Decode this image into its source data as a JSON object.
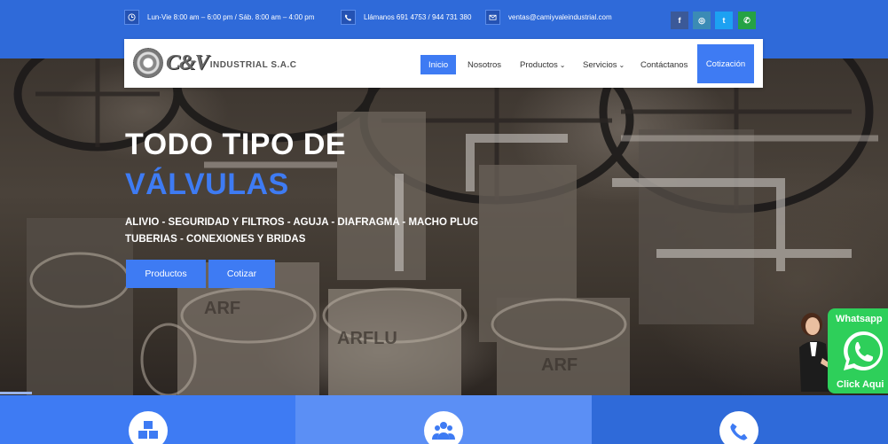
{
  "topbar": {
    "hours": "Lun-Vie 8:00 am – 6:00 pm / Sáb. 8:00 am – 4:00 pm",
    "phone": "Llámanos 691 4753 / 944 731 380",
    "email": "ventas@camiyvaleindustrial.com",
    "social": [
      {
        "name": "facebook",
        "glyph": "f",
        "color": "#3b5998"
      },
      {
        "name": "instagram",
        "glyph": "◎",
        "color": "#3b8bb5"
      },
      {
        "name": "twitter",
        "glyph": "t",
        "color": "#1da1f2"
      },
      {
        "name": "whatsapp",
        "glyph": "✆",
        "color": "#25a244"
      }
    ]
  },
  "logo": {
    "mark": "C&V",
    "sub": "INDUSTRIAL S.A.C"
  },
  "nav": {
    "items": [
      "Inicio",
      "Nosotros",
      "Productos",
      "Servicios",
      "Contáctanos"
    ],
    "active": "Inicio",
    "dropdown_items": [
      "Productos",
      "Servicios"
    ],
    "cta": "Cotización"
  },
  "hero": {
    "title_line1": "TODO TIPO DE",
    "title_line2": "VÁLVULAS",
    "sub_line1": "ALIVIO - SEGURIDAD Y FILTROS - AGUJA - DIAFRAGMA - MACHO PLUG",
    "sub_line2": "TUBERIAS - CONEXIONES Y BRIDAS",
    "btn_primary": "Productos",
    "btn_secondary": "Cotizar",
    "valve_marks": [
      "ARF",
      "ARFLU",
      "ARF"
    ]
  },
  "features": [
    {
      "icon": "cubes-icon",
      "color": "#3e7bf3"
    },
    {
      "icon": "users-icon",
      "color": "#5b8ff5"
    },
    {
      "icon": "phone-icon",
      "color": "#2f6ad9"
    }
  ],
  "whatsapp_widget": {
    "top_label": "Whatsapp",
    "bottom_label": "Click Aqui"
  },
  "colors": {
    "brand": "#3e7bf3",
    "topbar": "#2f6ad9",
    "whatsapp": "#2ecf5a"
  }
}
